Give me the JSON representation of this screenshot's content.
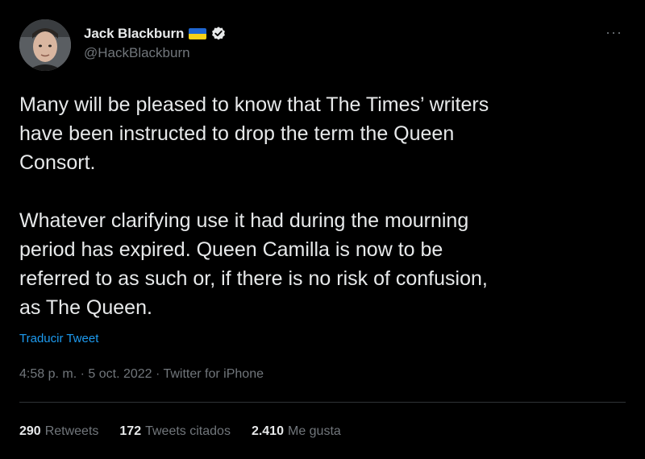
{
  "author": {
    "display_name": "Jack Blackburn",
    "handle": "@HackBlackburn",
    "flag": "ukraine-flag",
    "verified": true
  },
  "colors": {
    "background": "#000000",
    "text": "#e7e9ea",
    "secondary": "#71767b",
    "link": "#1d9bf0",
    "divider": "#2f3336"
  },
  "tweet": {
    "paragraph_1": "Many will be pleased to know that The Times’ writers\nhave been instructed to drop the term the Queen\nConsort.",
    "paragraph_2": "Whatever clarifying use it had during the mourning\nperiod has expired. Queen Camilla is now to be\nreferred to as such or, if there is no risk of confusion,\nas The Queen.",
    "translate_label": "Traducir Tweet"
  },
  "meta": {
    "time": "4:58 p. m.",
    "separator": " · ",
    "date": "5 oct. 2022",
    "source": "Twitter for iPhone"
  },
  "stats": {
    "retweets_count": "290",
    "retweets_label": "Retweets",
    "quotes_count": "172",
    "quotes_label": "Tweets citados",
    "likes_count": "2.410",
    "likes_label": "Me gusta"
  },
  "more_menu": "···"
}
